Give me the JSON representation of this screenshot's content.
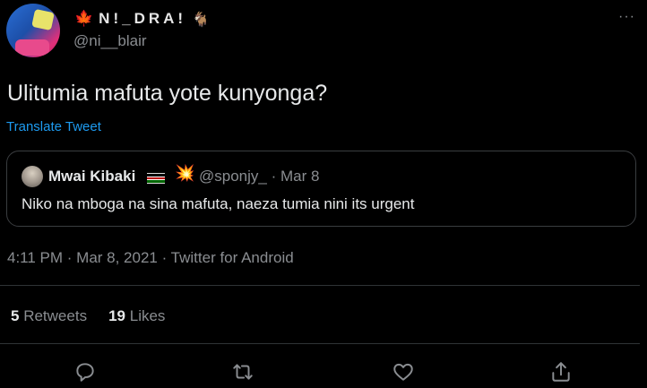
{
  "author": {
    "flag_emoji": "🍁",
    "display_name": "N!_DRA!",
    "goat_emoji": "🐐",
    "handle": "@ni__blair"
  },
  "tweet": {
    "text": "Ulitumia mafuta yote kunyonga?",
    "translate_label": "Translate Tweet",
    "meta": "4:11 PM · Mar 8, 2021 · Twitter for Android"
  },
  "quoted": {
    "name": "Mwai Kibaki",
    "burst_emoji": "💥",
    "handle_date": "@sponjy_ · Mar 8",
    "text": "Niko na mboga na sina mafuta, naeza tumia nini its urgent"
  },
  "stats": {
    "retweets_count": "5",
    "retweets_label": "Retweets",
    "likes_count": "19",
    "likes_label": "Likes"
  },
  "more_label": "···",
  "actions": [
    "reply-icon",
    "retweet-icon",
    "like-icon",
    "share-icon"
  ],
  "colors": {
    "background": "#000000",
    "link": "#1d9bf0",
    "secondary_text": "#8a8d91",
    "divider": "#2f3336"
  }
}
